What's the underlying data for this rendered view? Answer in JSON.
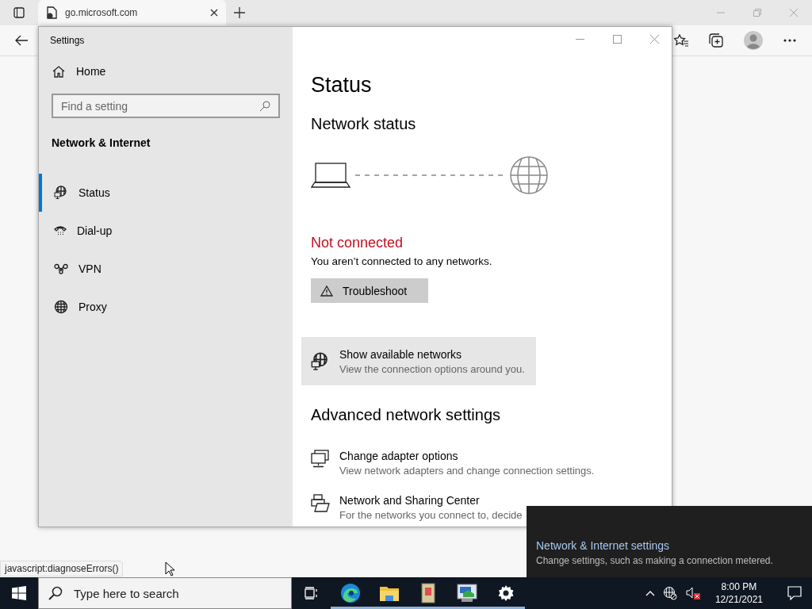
{
  "browser": {
    "tab": {
      "title": "go.microsoft.com",
      "selected": true
    },
    "status_url": "javascript:diagnoseErrors()"
  },
  "settings_window": {
    "title": "Settings",
    "home": "Home",
    "search": {
      "placeholder": "Find a setting"
    },
    "section": "Network & Internet",
    "nav": [
      {
        "kind": "status",
        "label": "Status",
        "selected": true
      },
      {
        "kind": "dialup",
        "label": "Dial-up",
        "selected": false
      },
      {
        "kind": "vpn",
        "label": "VPN",
        "selected": false
      },
      {
        "kind": "proxy",
        "label": "Proxy",
        "selected": false
      }
    ],
    "page_title": "Status",
    "network_status_heading": "Network status",
    "connection": {
      "connected": false,
      "status": "Not connected",
      "message": "You aren’t connected to any networks."
    },
    "troubleshoot": "Troubleshoot",
    "show_networks": {
      "title": "Show available networks",
      "description": "View the connection options around you.",
      "highlighted": true
    },
    "advanced_heading": "Advanced network settings",
    "links": [
      {
        "kind": "adapter",
        "title": "Change adapter options",
        "description": "View network adapters and change connection settings."
      },
      {
        "kind": "sharing",
        "title": "Network and Sharing Center",
        "description": "For the networks you connect to, decide"
      }
    ]
  },
  "toast": {
    "title": "Network & Internet settings",
    "description": "Change settings, such as making a connection metered."
  },
  "taskbar": {
    "search_placeholder": "Type here to search",
    "apps": [
      {
        "kind": "taskview",
        "running": false
      },
      {
        "kind": "browser",
        "running": true
      },
      {
        "kind": "folder",
        "running": true
      },
      {
        "kind": "notebook",
        "running": true
      },
      {
        "kind": "panel",
        "running": true
      },
      {
        "kind": "settings",
        "running": true
      }
    ],
    "time": "8:00 PM",
    "date": "12/21/2021"
  }
}
